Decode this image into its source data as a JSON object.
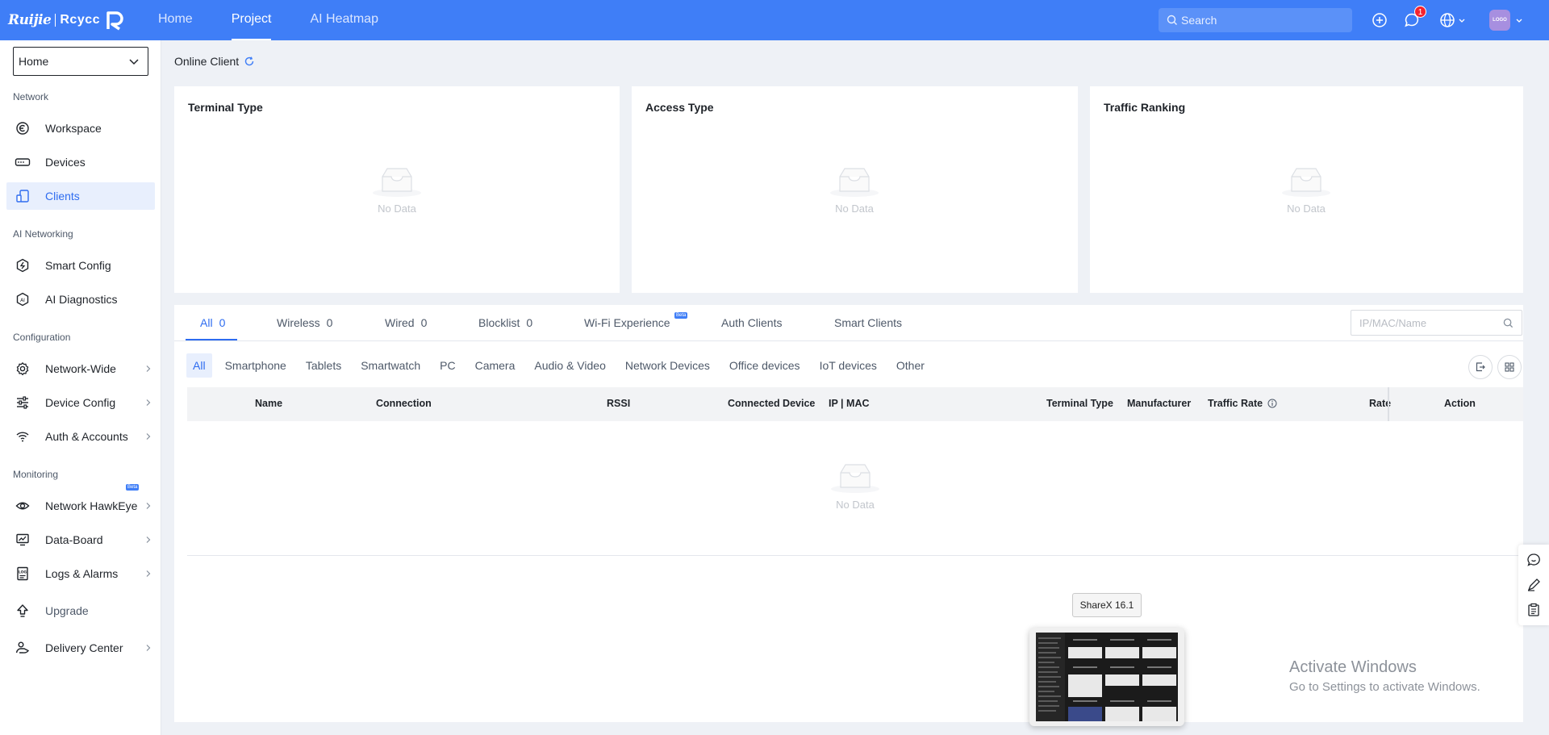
{
  "topbar": {
    "logo_brand": "Ruijie",
    "logo_product": "Rcycc",
    "nav": [
      "Home",
      "Project",
      "AI Heatmap"
    ],
    "active_nav": "Project",
    "search_placeholder": "Search",
    "notification_count": "1",
    "avatar_text": "LOGO"
  },
  "sidebar": {
    "project": "Home",
    "groups": {
      "network": "Network",
      "ai": "AI Networking",
      "config": "Configuration",
      "monitoring": "Monitoring"
    },
    "items": {
      "workspace": "Workspace",
      "devices": "Devices",
      "clients": "Clients",
      "smart_config": "Smart Config",
      "ai_diagnostics": "AI Diagnostics",
      "network_wide": "Network-Wide",
      "device_config": "Device Config",
      "auth_accounts": "Auth & Accounts",
      "hawkeye": "Network HawkEye",
      "data_board": "Data-Board",
      "logs_alarms": "Logs & Alarms",
      "upgrade": "Upgrade",
      "delivery_center": "Delivery Center"
    },
    "beta": "Beta"
  },
  "main": {
    "title": "Online Client",
    "cards": {
      "terminal_type": "Terminal Type",
      "access_type": "Access Type",
      "traffic_ranking": "Traffic Ranking"
    },
    "no_data": "No Data",
    "tabs": {
      "all": {
        "label": "All",
        "count": "0"
      },
      "wireless": {
        "label": "Wireless",
        "count": "0"
      },
      "wired": {
        "label": "Wired",
        "count": "0"
      },
      "blocklist": {
        "label": "Blocklist",
        "count": "0"
      },
      "wifi_experience": {
        "label": "Wi-Fi Experience"
      },
      "auth_clients": {
        "label": "Auth Clients"
      },
      "smart_clients": {
        "label": "Smart Clients"
      }
    },
    "tab_beta": "Beta",
    "filter_placeholder": "IP/MAC/Name",
    "chips": [
      "All",
      "Smartphone",
      "Tablets",
      "Smartwatch",
      "PC",
      "Camera",
      "Audio & Video",
      "Network Devices",
      "Office devices",
      "IoT devices",
      "Other"
    ],
    "columns": {
      "name": "Name",
      "connection": "Connection",
      "rssi": "RSSI",
      "connected_device": "Connected Device",
      "ip_mac": "IP | MAC",
      "terminal_type": "Terminal Type",
      "manufacturer": "Manufacturer",
      "traffic_rate": "Traffic Rate",
      "rate": "Rate",
      "action": "Action"
    }
  },
  "overlay": {
    "taskbar_tooltip": "ShareX 16.1",
    "activate_title": "Activate Windows",
    "activate_sub": "Go to Settings to activate Windows."
  },
  "colors": {
    "brand": "#3f7ef7",
    "active_text": "#2e6cf0",
    "active_bg": "#e8effd",
    "badge": "#f5222d"
  }
}
